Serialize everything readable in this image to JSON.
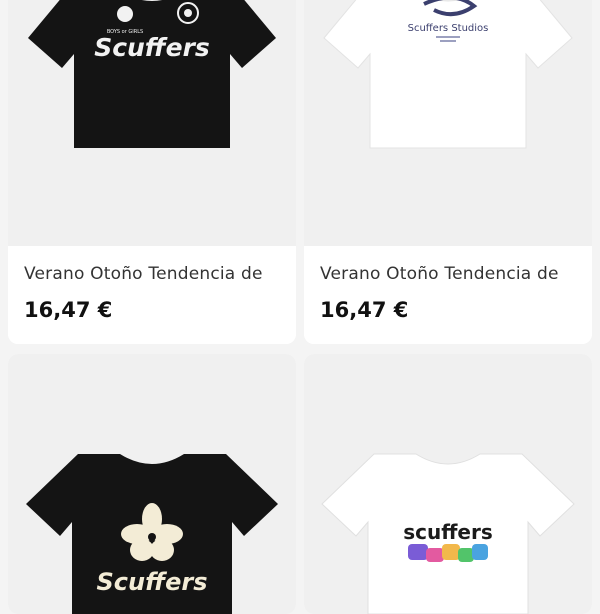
{
  "products": [
    {
      "title": "Verano Otoño Tendencia de",
      "price": "16,47 €",
      "shirt_color": "#141414",
      "print": {
        "brand": "Scuffers",
        "tag": "BOYS or GIRLS",
        "icon": "flower-emblem-icon"
      }
    },
    {
      "title": "Verano Otoño Tendencia de",
      "price": "16,47 €",
      "shirt_color": "#ffffff",
      "print": {
        "brand": "Scuffers Studios",
        "icon": "snake-icon"
      }
    },
    {
      "title": "",
      "price": "",
      "shirt_color": "#141414",
      "print": {
        "brand": "Scuffers",
        "icon": "hibiscus-flower-icon"
      }
    },
    {
      "title": "",
      "price": "",
      "shirt_color": "#ffffff",
      "print": {
        "brand": "scuffers",
        "icon": "graffiti-text-icon"
      }
    }
  ],
  "colors": {
    "background": "#f4f4f4",
    "card": "#ffffff",
    "image_bg": "#f0f0f0",
    "price": "#111111"
  }
}
